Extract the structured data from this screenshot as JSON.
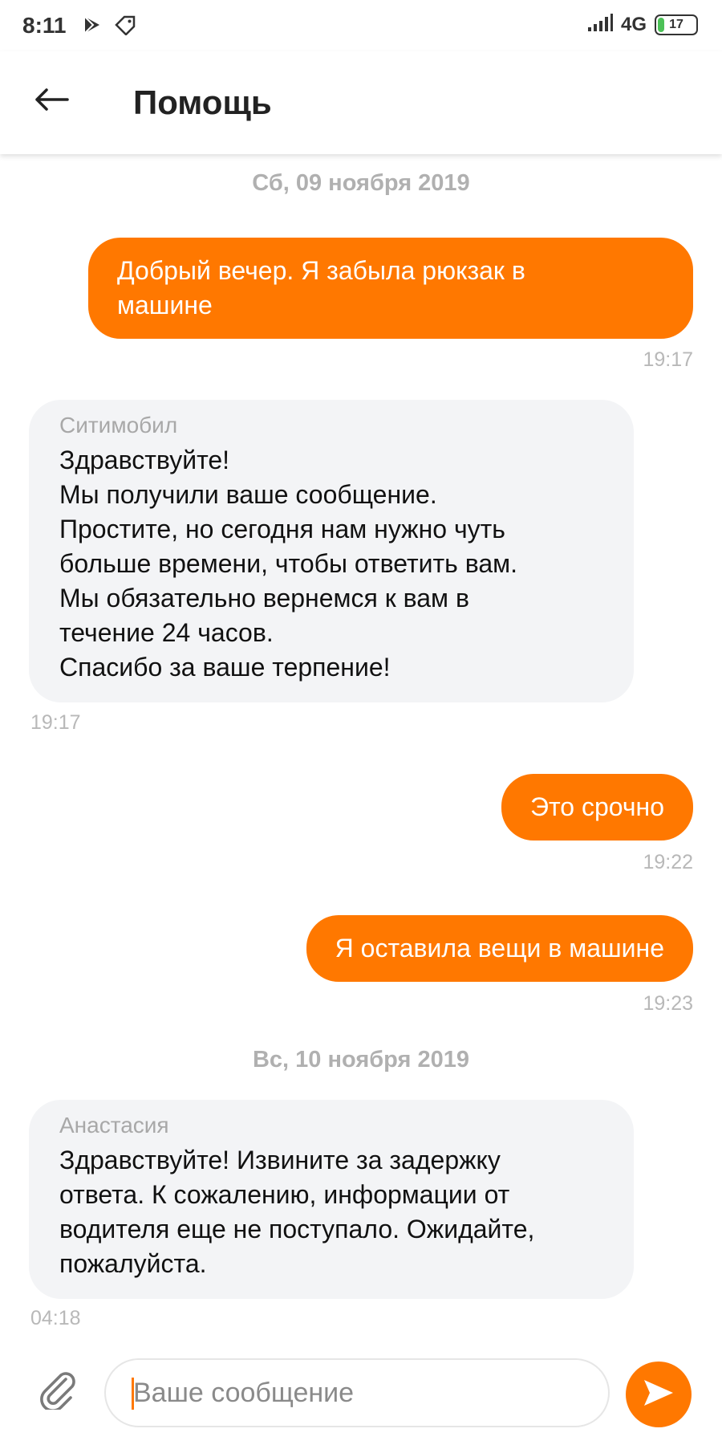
{
  "status_bar": {
    "time": "8:11",
    "network": "4G",
    "battery": "17",
    "battery_level_percent": 17,
    "icons": [
      "play-store-icon",
      "tag-icon",
      "signal-icon",
      "battery-icon"
    ]
  },
  "header": {
    "title": "Помощь",
    "back_icon": "arrow-left-icon"
  },
  "chat": {
    "date_1": "Сб, 09 ноября 2019",
    "msg_1": {
      "lines": [
        "Добрый вечер. Я забыла рюкзак в",
        "машине"
      ],
      "time": "19:17"
    },
    "msg_2": {
      "sender": "Ситимобил",
      "lines": [
        "Здравствуйте!",
        "Мы получили ваше сообщение.",
        "Простите, но сегодня нам нужно чуть",
        "больше времени, чтобы ответить вам.",
        "Мы обязательно вернемся к вам в",
        "течение 24 часов.",
        "Спасибо за ваше терпение!"
      ],
      "time": "19:17"
    },
    "msg_3": {
      "text": "Это срочно",
      "time": "19:22"
    },
    "msg_4": {
      "text": "Я оставила вещи в машине",
      "time": "19:23"
    },
    "date_2": "Вс, 10 ноября 2019",
    "msg_5": {
      "sender": "Анастасия",
      "lines": [
        "Здравствуйте! Извините за задержку",
        "ответа. К сожалению, информации от",
        "водителя еще не поступало. Ожидайте,",
        "пожалуйста."
      ],
      "time": "04:18"
    }
  },
  "composer": {
    "placeholder": "Ваше сообщение",
    "attach_icon": "paperclip-icon",
    "send_icon": "send-icon"
  },
  "colors": {
    "accent": "#ff7800",
    "incoming_bubble": "#f3f4f6",
    "muted_text": "#b0b0b0"
  }
}
